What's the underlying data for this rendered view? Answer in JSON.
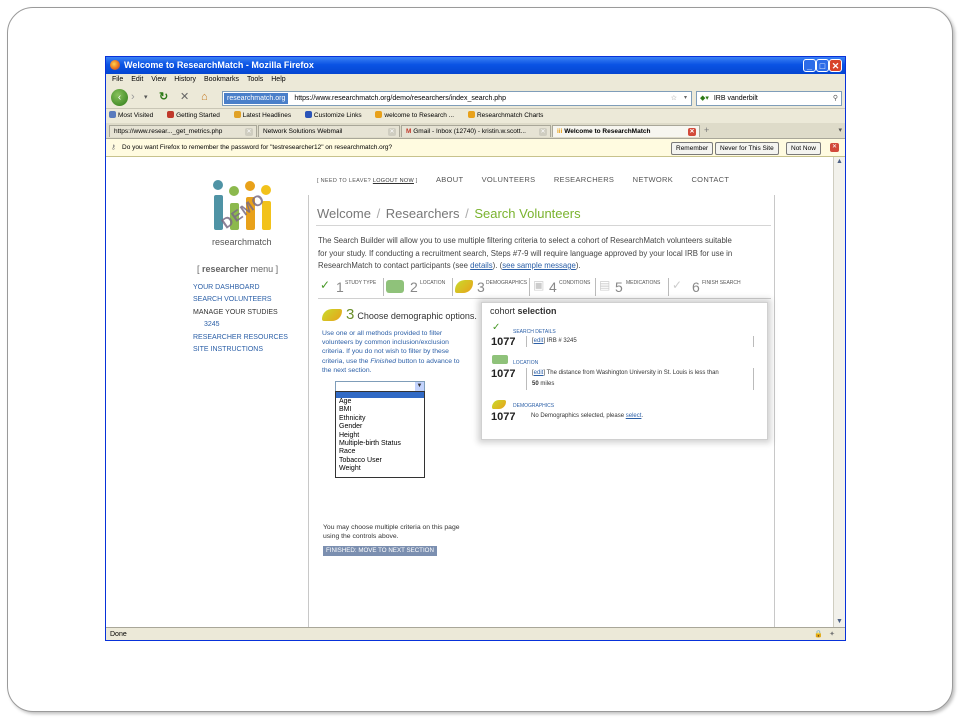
{
  "window": {
    "title": "Welcome to ResearchMatch - Mozilla Firefox"
  },
  "menu": [
    "File",
    "Edit",
    "View",
    "History",
    "Bookmarks",
    "Tools",
    "Help"
  ],
  "navigation": {
    "site_badge": "researchmatch.org",
    "url": "https://www.researchmatch.org/demo/researchers/index_search.php",
    "search_value": "IRB vanderbilt"
  },
  "bookmarks": [
    "Most Visited",
    "Getting Started",
    "Latest Headlines",
    "Customize Links",
    "welcome to Research ...",
    "Researchmatch Charts"
  ],
  "tabs": [
    {
      "label": "https://www.resear..._get_metrics.php"
    },
    {
      "label": "Network Solutions Webmail"
    },
    {
      "label": "Gmail - Inbox (12740) - kristin.w.scott..."
    },
    {
      "label": "Welcome to ResearchMatch"
    }
  ],
  "notification": {
    "message": "Do you want Firefox to remember the password for \"testresearcher12\" on researchmatch.org?",
    "buttons": [
      "Remember",
      "Never for This Site",
      "Not Now"
    ]
  },
  "status": {
    "text": "Done"
  },
  "site": {
    "logo_text": "researchmatch",
    "demo_stamp": "DEMO",
    "top_nav": {
      "need_prefix": "[ NEED TO LEAVE?",
      "logout": "LOGOUT NOW",
      "need_suffix": "]",
      "items": [
        "ABOUT",
        "VOLUNTEERS",
        "RESEARCHERS",
        "NETWORK",
        "CONTACT"
      ]
    },
    "left_nav": {
      "header_bold": "researcher",
      "header_rest": "menu",
      "items": [
        "YOUR DASHBOARD",
        "SEARCH VOLUNTEERS",
        "MANAGE YOUR STUDIES",
        "3245",
        "RESEARCHER RESOURCES",
        "SITE INSTRUCTIONS"
      ]
    },
    "breadcrumb": [
      "Welcome",
      "Researchers",
      "Search Volunteers"
    ],
    "intro": {
      "text": "The Search Builder will allow you to use multiple filtering criteria to select a cohort of ResearchMatch volunteers suitable for your study. If conducting a recruitment search, Steps #7-9 will require language approved by your local IRB for use in ResearchMatch to contact participants (see ",
      "link1": "details",
      "mid": "). (",
      "link2": "see sample message",
      "end": ")."
    },
    "steps": [
      {
        "num": "1",
        "label": "STUDY TYPE"
      },
      {
        "num": "2",
        "label": "LOCATION"
      },
      {
        "num": "3",
        "label": "DEMOGRAPHICS"
      },
      {
        "num": "4",
        "label": "CONDITIONS"
      },
      {
        "num": "5",
        "label": "MEDICATIONS"
      },
      {
        "num": "6",
        "label": "FINISH SEARCH"
      }
    ],
    "demographics": {
      "step_num": "3",
      "title": "Choose demographic options.",
      "desc_before": "Use one or all methods provided to filter volunteers by common inclusion/exclusion criteria. If you do not wish to filter by these criteria, use the ",
      "desc_em": "Finished",
      "desc_after": " button to advance to the next section.",
      "options": [
        "Age",
        "BMI",
        "Ethnicity",
        "Gender",
        "Height",
        "Multiple-birth Status",
        "Race",
        "Tobacco User",
        "Weight"
      ],
      "multiple_note": "You may choose multiple criteria on this page using the controls above.",
      "finish_button": "FINISHED: MOVE TO NEXT SECTION"
    },
    "cohort": {
      "title_light": "cohort",
      "title_bold": "selection",
      "sections": [
        {
          "label": "SEARCH DETAILS",
          "count": "1077",
          "edit": "edit",
          "desc": "] IRB # 3245"
        },
        {
          "label": "LOCATION",
          "count": "1077",
          "edit": "edit",
          "desc": "] The distance from Washington University in St. Louis is less than",
          "desc2": "50",
          "desc3": "miles"
        },
        {
          "label": "DEMOGRAPHICS",
          "count": "1077",
          "desc": "No Demographics selected, please",
          "link": "select"
        }
      ]
    }
  },
  "colors": {
    "accent_green": "#7ab32e",
    "link_blue": "#2b5fa7",
    "title_blue": "#0a53e4"
  }
}
